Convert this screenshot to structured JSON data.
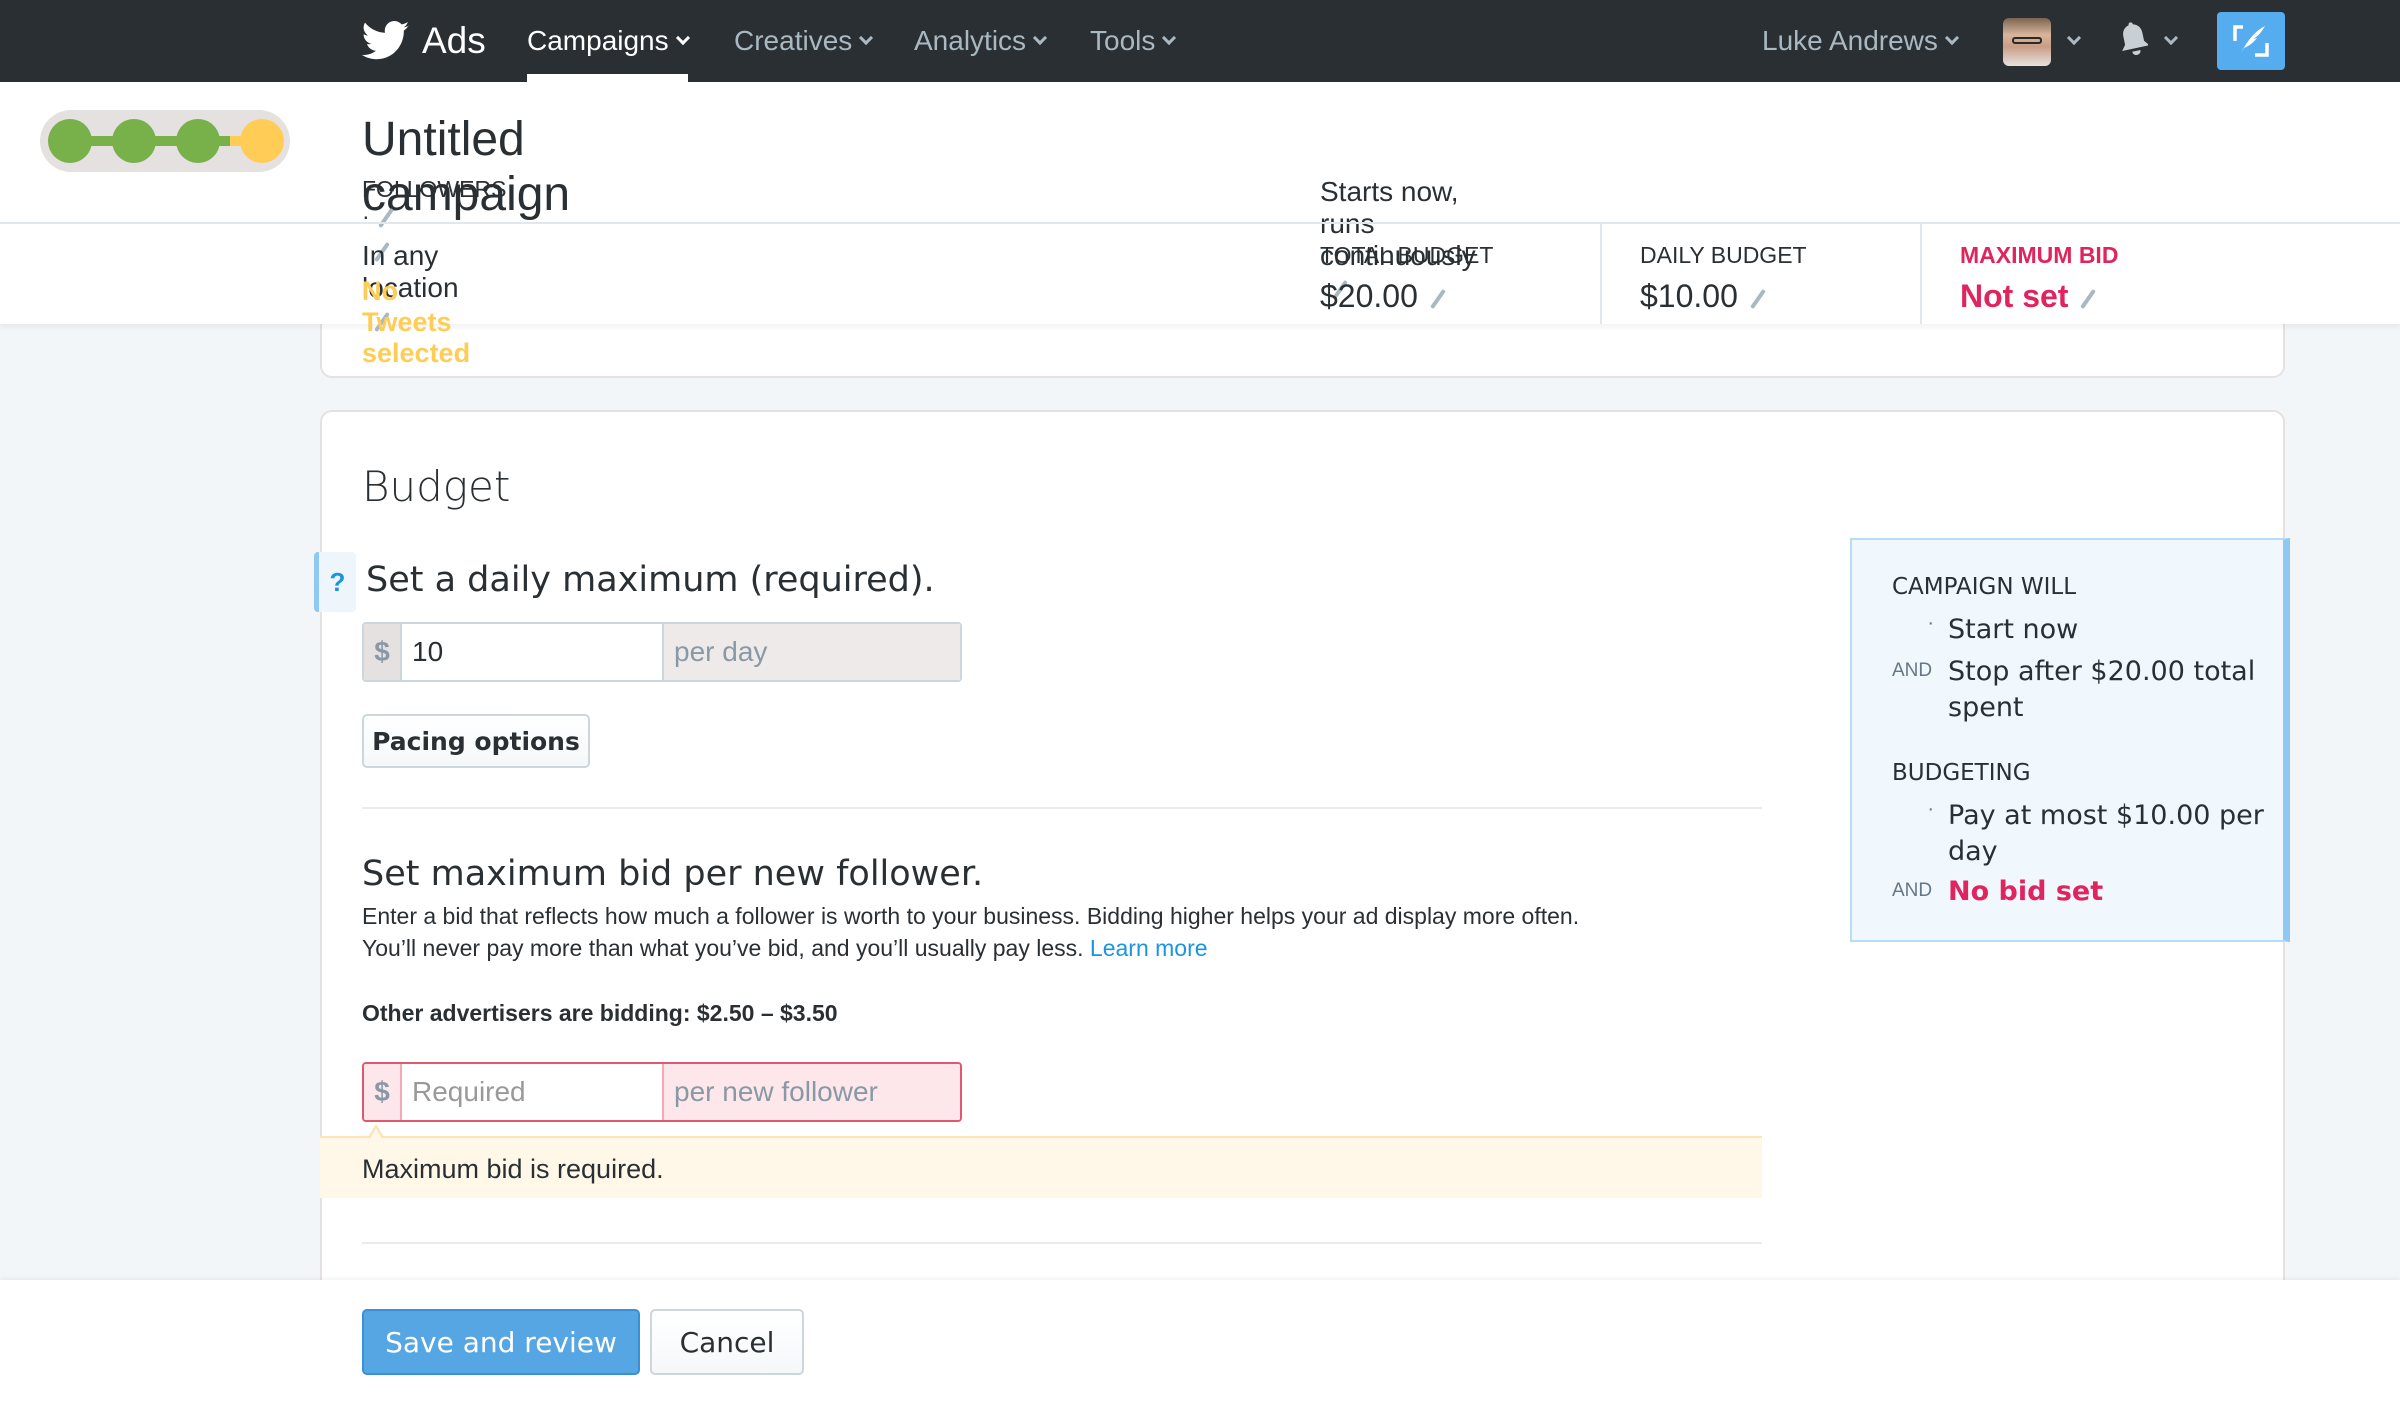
{
  "nav": {
    "brand": "Ads",
    "items": [
      {
        "label": "Campaigns",
        "active": true
      },
      {
        "label": "Creatives",
        "active": false
      },
      {
        "label": "Analytics",
        "active": false
      },
      {
        "label": "Tools",
        "active": false
      }
    ],
    "user_name": "Luke Andrews",
    "icons": [
      "twitter-bird-icon",
      "avatar",
      "bell-icon",
      "compose-icon"
    ]
  },
  "header": {
    "progress_steps": [
      {
        "status": "complete",
        "color": "#78b04a"
      },
      {
        "status": "complete",
        "color": "#78b04a"
      },
      {
        "status": "complete",
        "color": "#78b04a"
      },
      {
        "status": "current",
        "color": "#ffcd56"
      }
    ],
    "campaign_title": "Untitled campaign",
    "objective": "FOLLOWERS ·",
    "schedule": "Starts now, runs continuously",
    "location": "In any location",
    "location_sep": "·",
    "tweets": "No Tweets selected",
    "stats": [
      {
        "label": "TOTAL BUDGET",
        "value": "$20.00"
      },
      {
        "label": "DAILY BUDGET",
        "value": "$10.00"
      },
      {
        "label": "MAXIMUM BID",
        "value": "Not set",
        "error": true
      }
    ]
  },
  "budget": {
    "heading": "Budget",
    "help": "?",
    "daily_heading": "Set a daily maximum (required).",
    "daily_currency": "$",
    "daily_value": "10",
    "daily_suffix": "per day",
    "pacing_button": "Pacing options",
    "bid_heading": "Set maximum bid per new follower.",
    "bid_description": "Enter a bid that reflects how much a follower is worth to your business. Bidding higher helps your ad display more often. You’ll never pay more than what you’ve bid, and you’ll usually pay less.",
    "learn_more": "Learn more",
    "others_bidding": "Other advertisers are bidding: $2.50 – $3.50",
    "bid_currency": "$",
    "bid_placeholder": "Required",
    "bid_value": "",
    "bid_suffix": "per new follower",
    "bid_error": "Maximum bid is required."
  },
  "summary": {
    "campaign_will_heading": "CAMPAIGN WILL",
    "start": "Start now",
    "and1": "AND",
    "stop": "Stop after $20.00 total spent",
    "budgeting_heading": "BUDGETING",
    "pay": "Pay at most $10.00 per day",
    "and2": "AND",
    "no_bid": "No bid set"
  },
  "footer": {
    "save": "Save and review",
    "cancel": "Cancel"
  },
  "colors": {
    "nav_bg": "#292f33",
    "accent": "#55acee",
    "error": "#e0245e",
    "warning": "#ffcd56",
    "success": "#78b04a"
  }
}
